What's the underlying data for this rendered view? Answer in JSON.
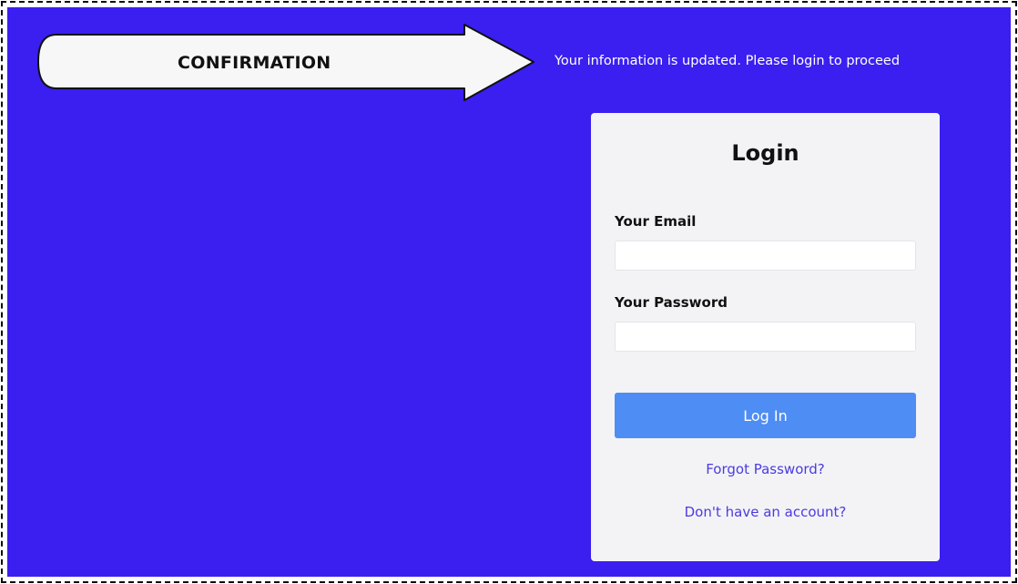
{
  "banner": {
    "arrow_label": "CONFIRMATION",
    "message": "Your information is updated. Please login to proceed"
  },
  "login": {
    "title": "Login",
    "email_label": "Your Email",
    "email_value": "",
    "password_label": "Your Password",
    "password_value": "",
    "submit_label": "Log In",
    "forgot_link": "Forgot Password?",
    "signup_link": "Don't have an account?"
  },
  "colors": {
    "background": "#3a1ff0",
    "card": "#f3f3f6",
    "button": "#4e8df3",
    "link": "#4b3be0"
  }
}
